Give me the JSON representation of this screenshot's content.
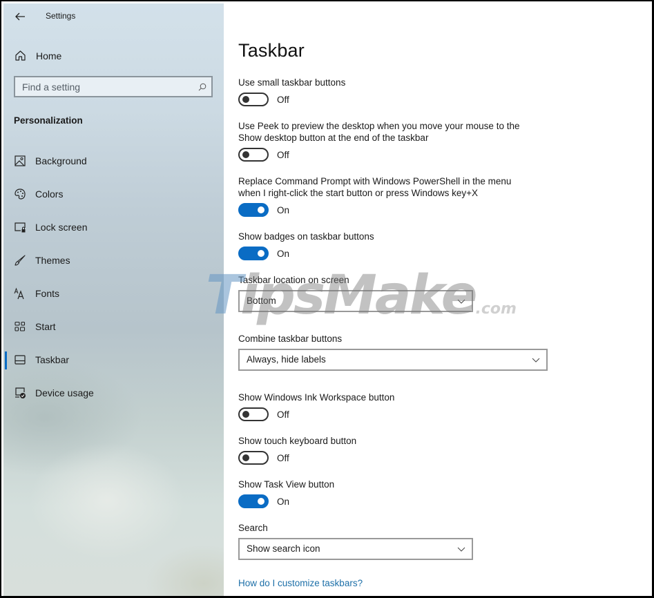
{
  "window": {
    "app_title": "Settings",
    "back_icon": "arrow-left-icon"
  },
  "sidebar": {
    "home_label": "Home",
    "home_icon": "home-icon",
    "search_placeholder": "Find a setting",
    "search_icon": "search-icon",
    "section_title": "Personalization",
    "items": [
      {
        "label": "Background",
        "icon": "picture-icon",
        "active": false
      },
      {
        "label": "Colors",
        "icon": "palette-icon",
        "active": false
      },
      {
        "label": "Lock screen",
        "icon": "lock-screen-icon",
        "active": false
      },
      {
        "label": "Themes",
        "icon": "brush-icon",
        "active": false
      },
      {
        "label": "Fonts",
        "icon": "fonts-icon",
        "active": false
      },
      {
        "label": "Start",
        "icon": "start-tiles-icon",
        "active": false
      },
      {
        "label": "Taskbar",
        "icon": "taskbar-icon",
        "active": true
      },
      {
        "label": "Device usage",
        "icon": "device-usage-icon",
        "active": false
      }
    ]
  },
  "main": {
    "title": "Taskbar",
    "settings": [
      {
        "type": "toggle",
        "label": "Use small taskbar buttons",
        "state": false,
        "state_label": "Off"
      },
      {
        "type": "toggle",
        "label": "Use Peek to preview the desktop when you move your mouse to the Show desktop button at the end of the taskbar",
        "state": false,
        "state_label": "Off"
      },
      {
        "type": "toggle",
        "label": "Replace Command Prompt with Windows PowerShell in the menu when I right-click the start button or press Windows key+X",
        "state": true,
        "state_label": "On"
      },
      {
        "type": "toggle",
        "label": "Show badges on taskbar buttons",
        "state": true,
        "state_label": "On"
      },
      {
        "type": "dropdown",
        "label": "Taskbar location on screen",
        "value": "Bottom"
      },
      {
        "type": "dropdown",
        "label": "Combine taskbar buttons",
        "value": "Always, hide labels"
      },
      {
        "type": "toggle",
        "label": "Show Windows Ink Workspace button",
        "state": false,
        "state_label": "Off"
      },
      {
        "type": "toggle",
        "label": "Show touch keyboard button",
        "state": false,
        "state_label": "Off"
      },
      {
        "type": "toggle",
        "label": "Show Task View button",
        "state": true,
        "state_label": "On"
      },
      {
        "type": "dropdown",
        "label": "Search",
        "value": "Show search icon"
      }
    ],
    "help_link": "How do I customize taskbars?"
  },
  "watermark": {
    "brand_t": "T",
    "brand_rest": "ipsMake",
    "suffix": ".com"
  },
  "colors": {
    "accent": "#0a6cc4",
    "link": "#1c6fa8",
    "active_indicator": "#0a6cc4"
  }
}
